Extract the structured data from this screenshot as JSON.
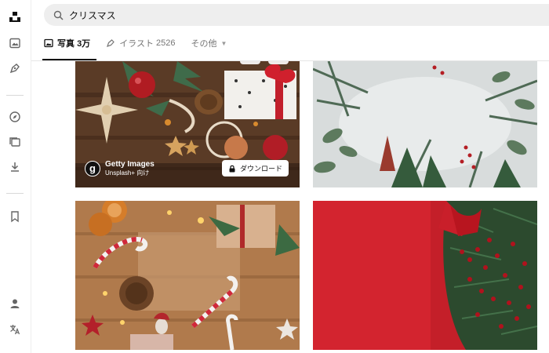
{
  "search": {
    "query": "クリスマス"
  },
  "tabs": [
    {
      "label": "写真",
      "count": "3万",
      "icon": "photo-icon"
    },
    {
      "label": "イラスト",
      "count": "2526",
      "icon": "pen-icon"
    },
    {
      "label": "その他",
      "icon": "chevron-down-icon"
    }
  ],
  "sidebar": {
    "icons": [
      "unsplash-logo-icon",
      "image-icon",
      "pen-icon",
      "compass-icon",
      "collections-icon",
      "download-icon",
      "bookmark-icon",
      "user-icon",
      "translate-icon"
    ]
  },
  "photos": {
    "first": {
      "sponsor_name": "Getty Images",
      "sponsor_sub": "Unsplash+ 向け",
      "download_label": "ダウンロード"
    }
  },
  "colors": {
    "accent": "#111111",
    "search_bg": "#eeeeee",
    "red_background": "#d3242f"
  }
}
